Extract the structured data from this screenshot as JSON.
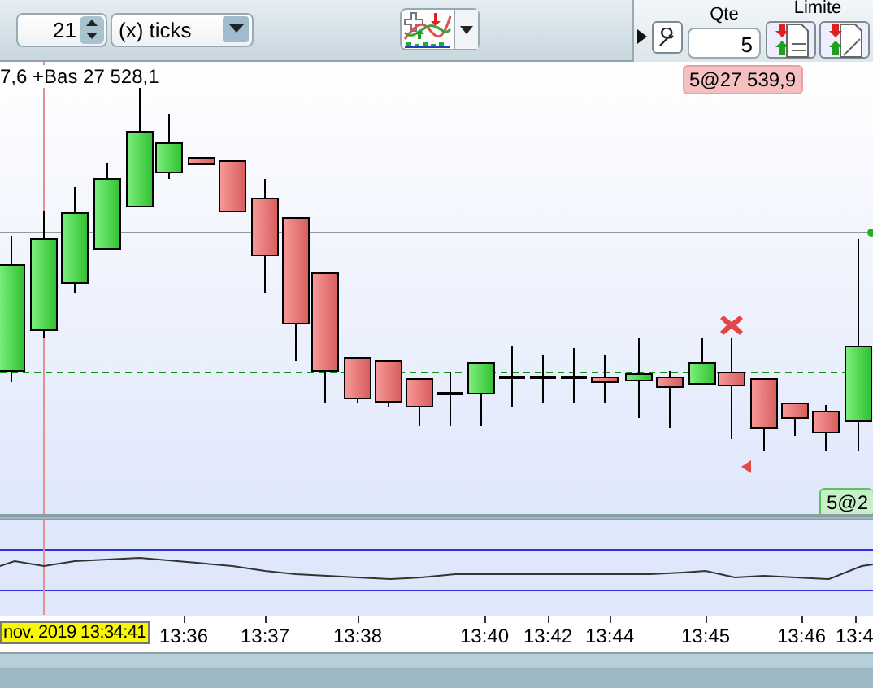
{
  "toolbar": {
    "period_value": "21",
    "period_unit": "(x) ticks"
  },
  "order_panel": {
    "qty_label": "Qte",
    "qty": "5",
    "limit_label": "Limite"
  },
  "chart": {
    "header_text": "7,6 +Bas 27 528,1",
    "order_tag": "5@27 539,9",
    "position_tag": "5@2"
  },
  "time_axis": {
    "cursor_time": "nov. 2019 13:34:41",
    "labels": [
      "13:36",
      "13:37",
      "13:38",
      "13:40",
      "13:42",
      "13:44",
      "13:45",
      "13:46",
      "13:4"
    ]
  }
}
